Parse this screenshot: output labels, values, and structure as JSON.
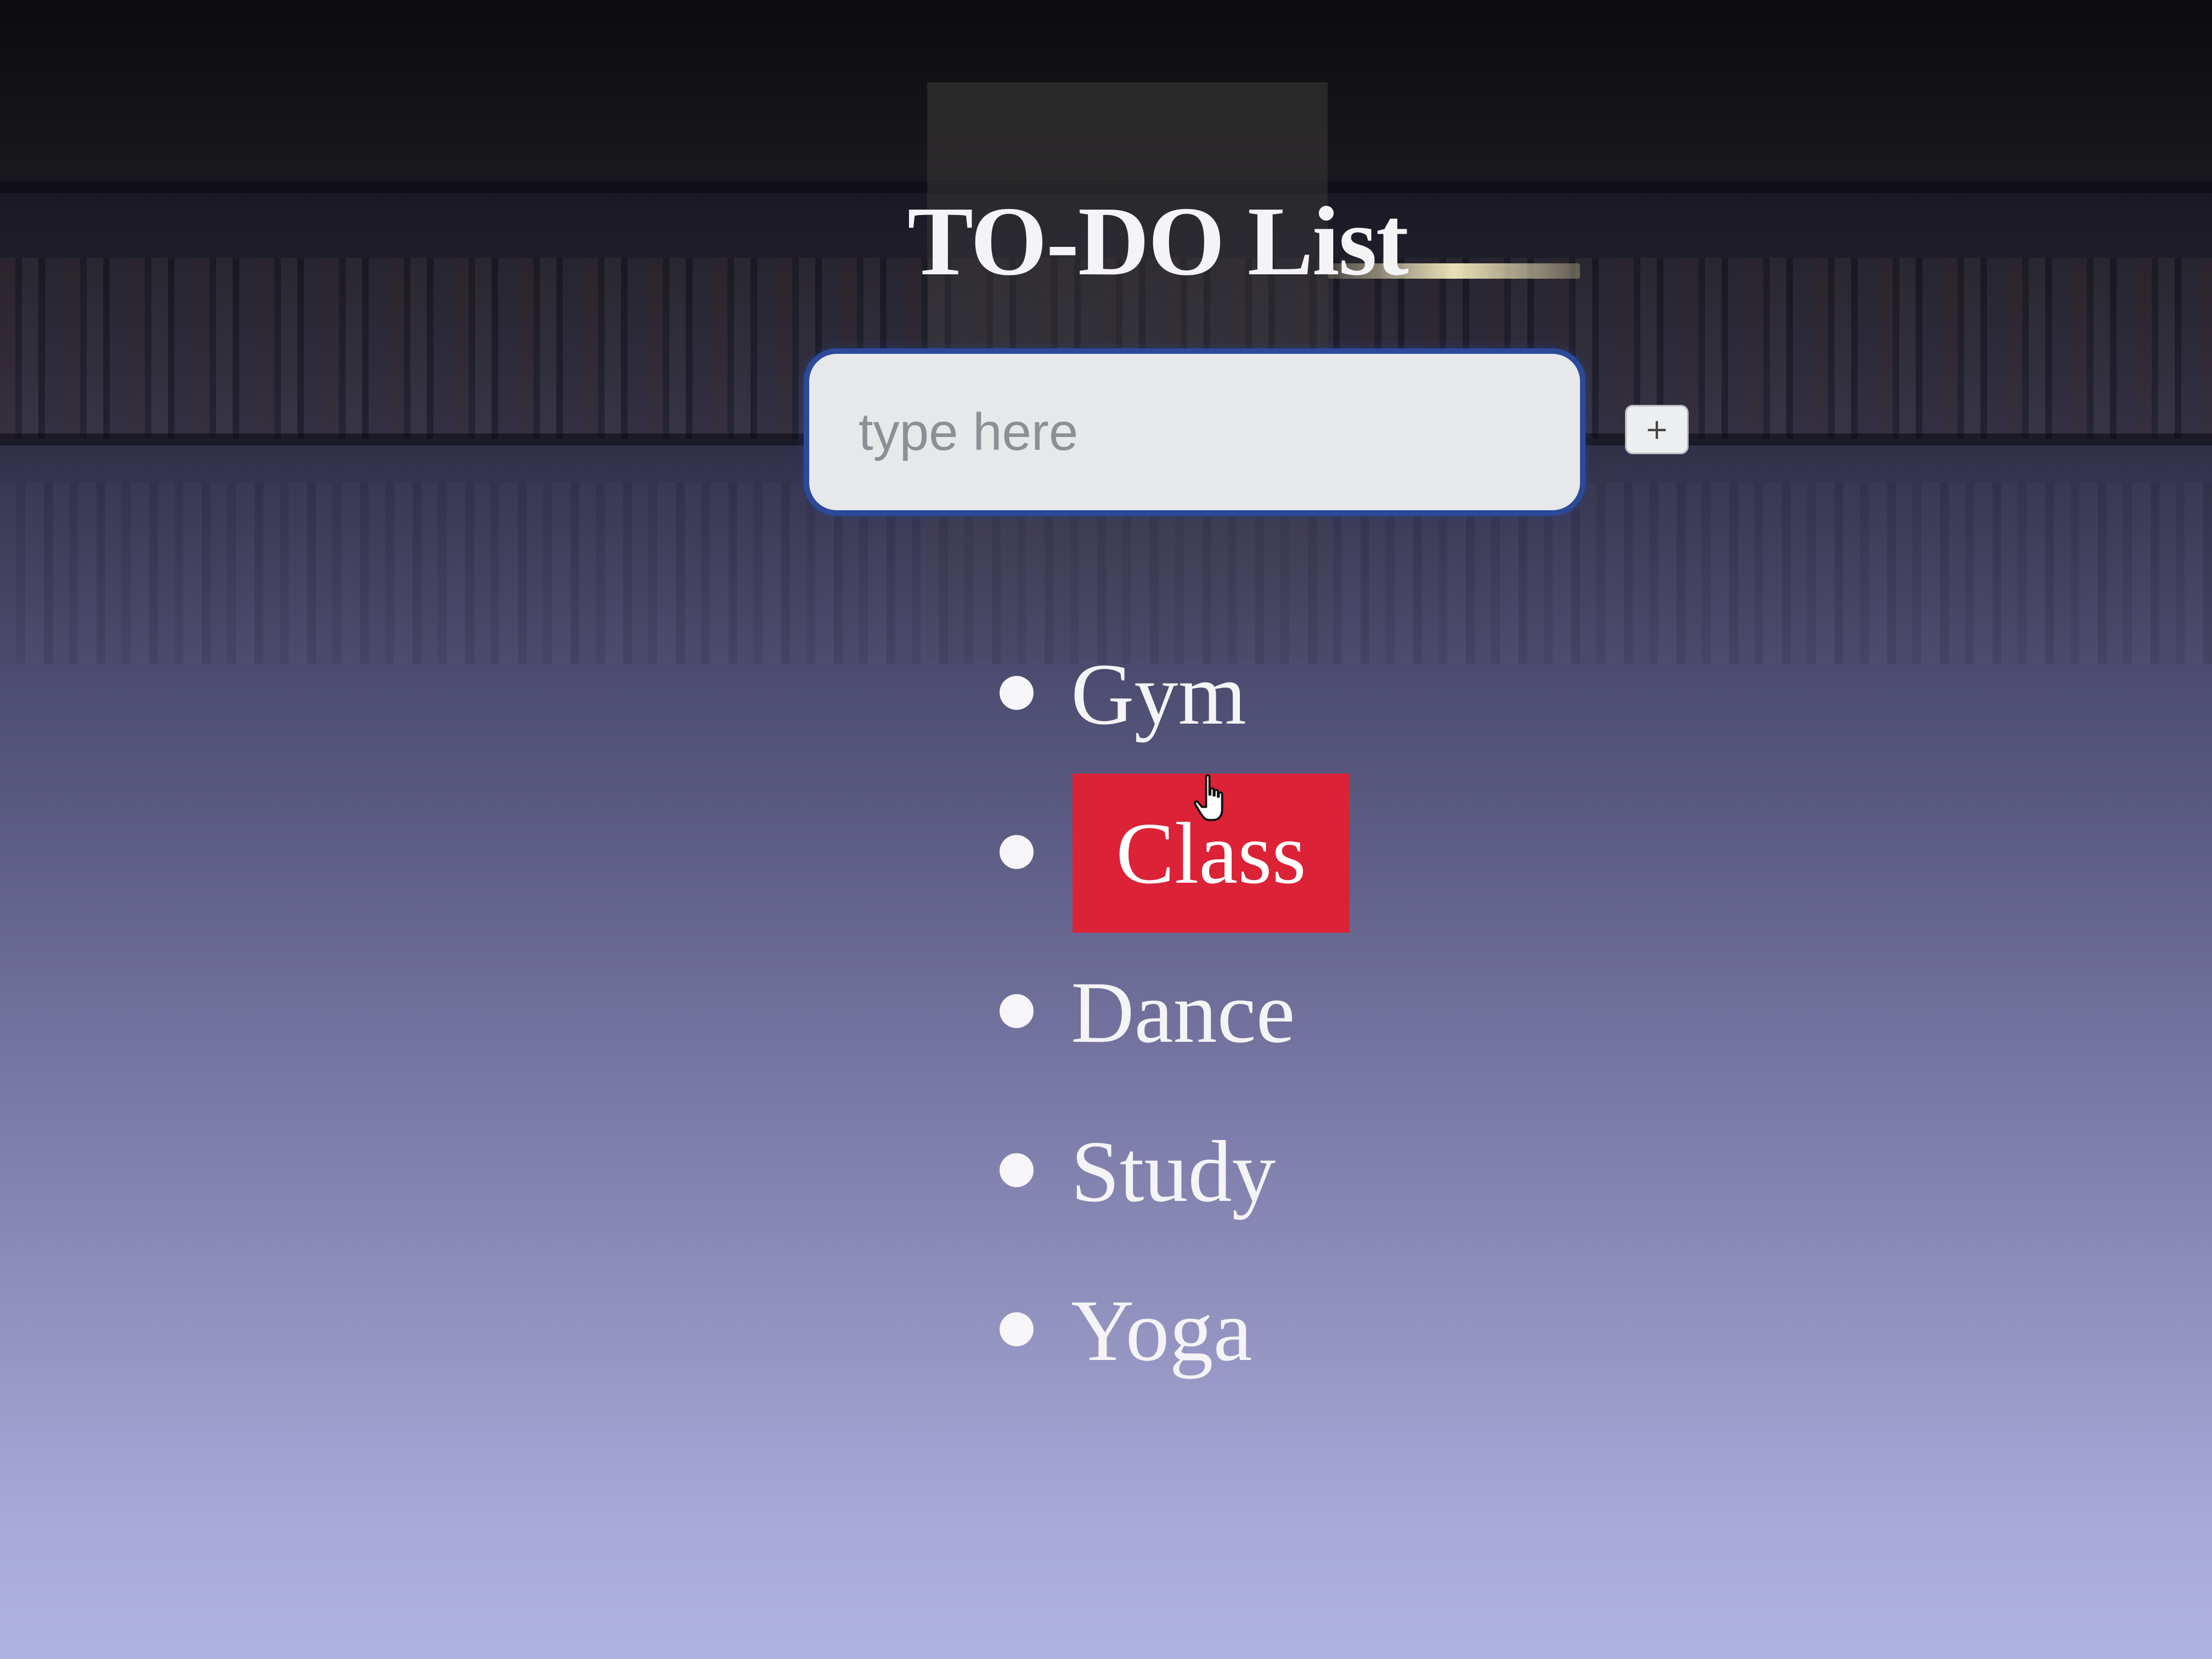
{
  "app": {
    "title": "TO-DO List"
  },
  "input": {
    "placeholder": "type here",
    "value": ""
  },
  "add_button": {
    "label": "+"
  },
  "todos": [
    {
      "label": "Gym",
      "hovered": false
    },
    {
      "label": "Class",
      "hovered": true
    },
    {
      "label": "Dance",
      "hovered": false
    },
    {
      "label": "Study",
      "hovered": false
    },
    {
      "label": "Yoga",
      "hovered": false
    }
  ],
  "colors": {
    "hover_highlight": "#dc2236",
    "input_border": "#2c4a9a",
    "text": "#f4f4f6"
  },
  "icons": {
    "cursor": "hand-pointer-icon"
  }
}
